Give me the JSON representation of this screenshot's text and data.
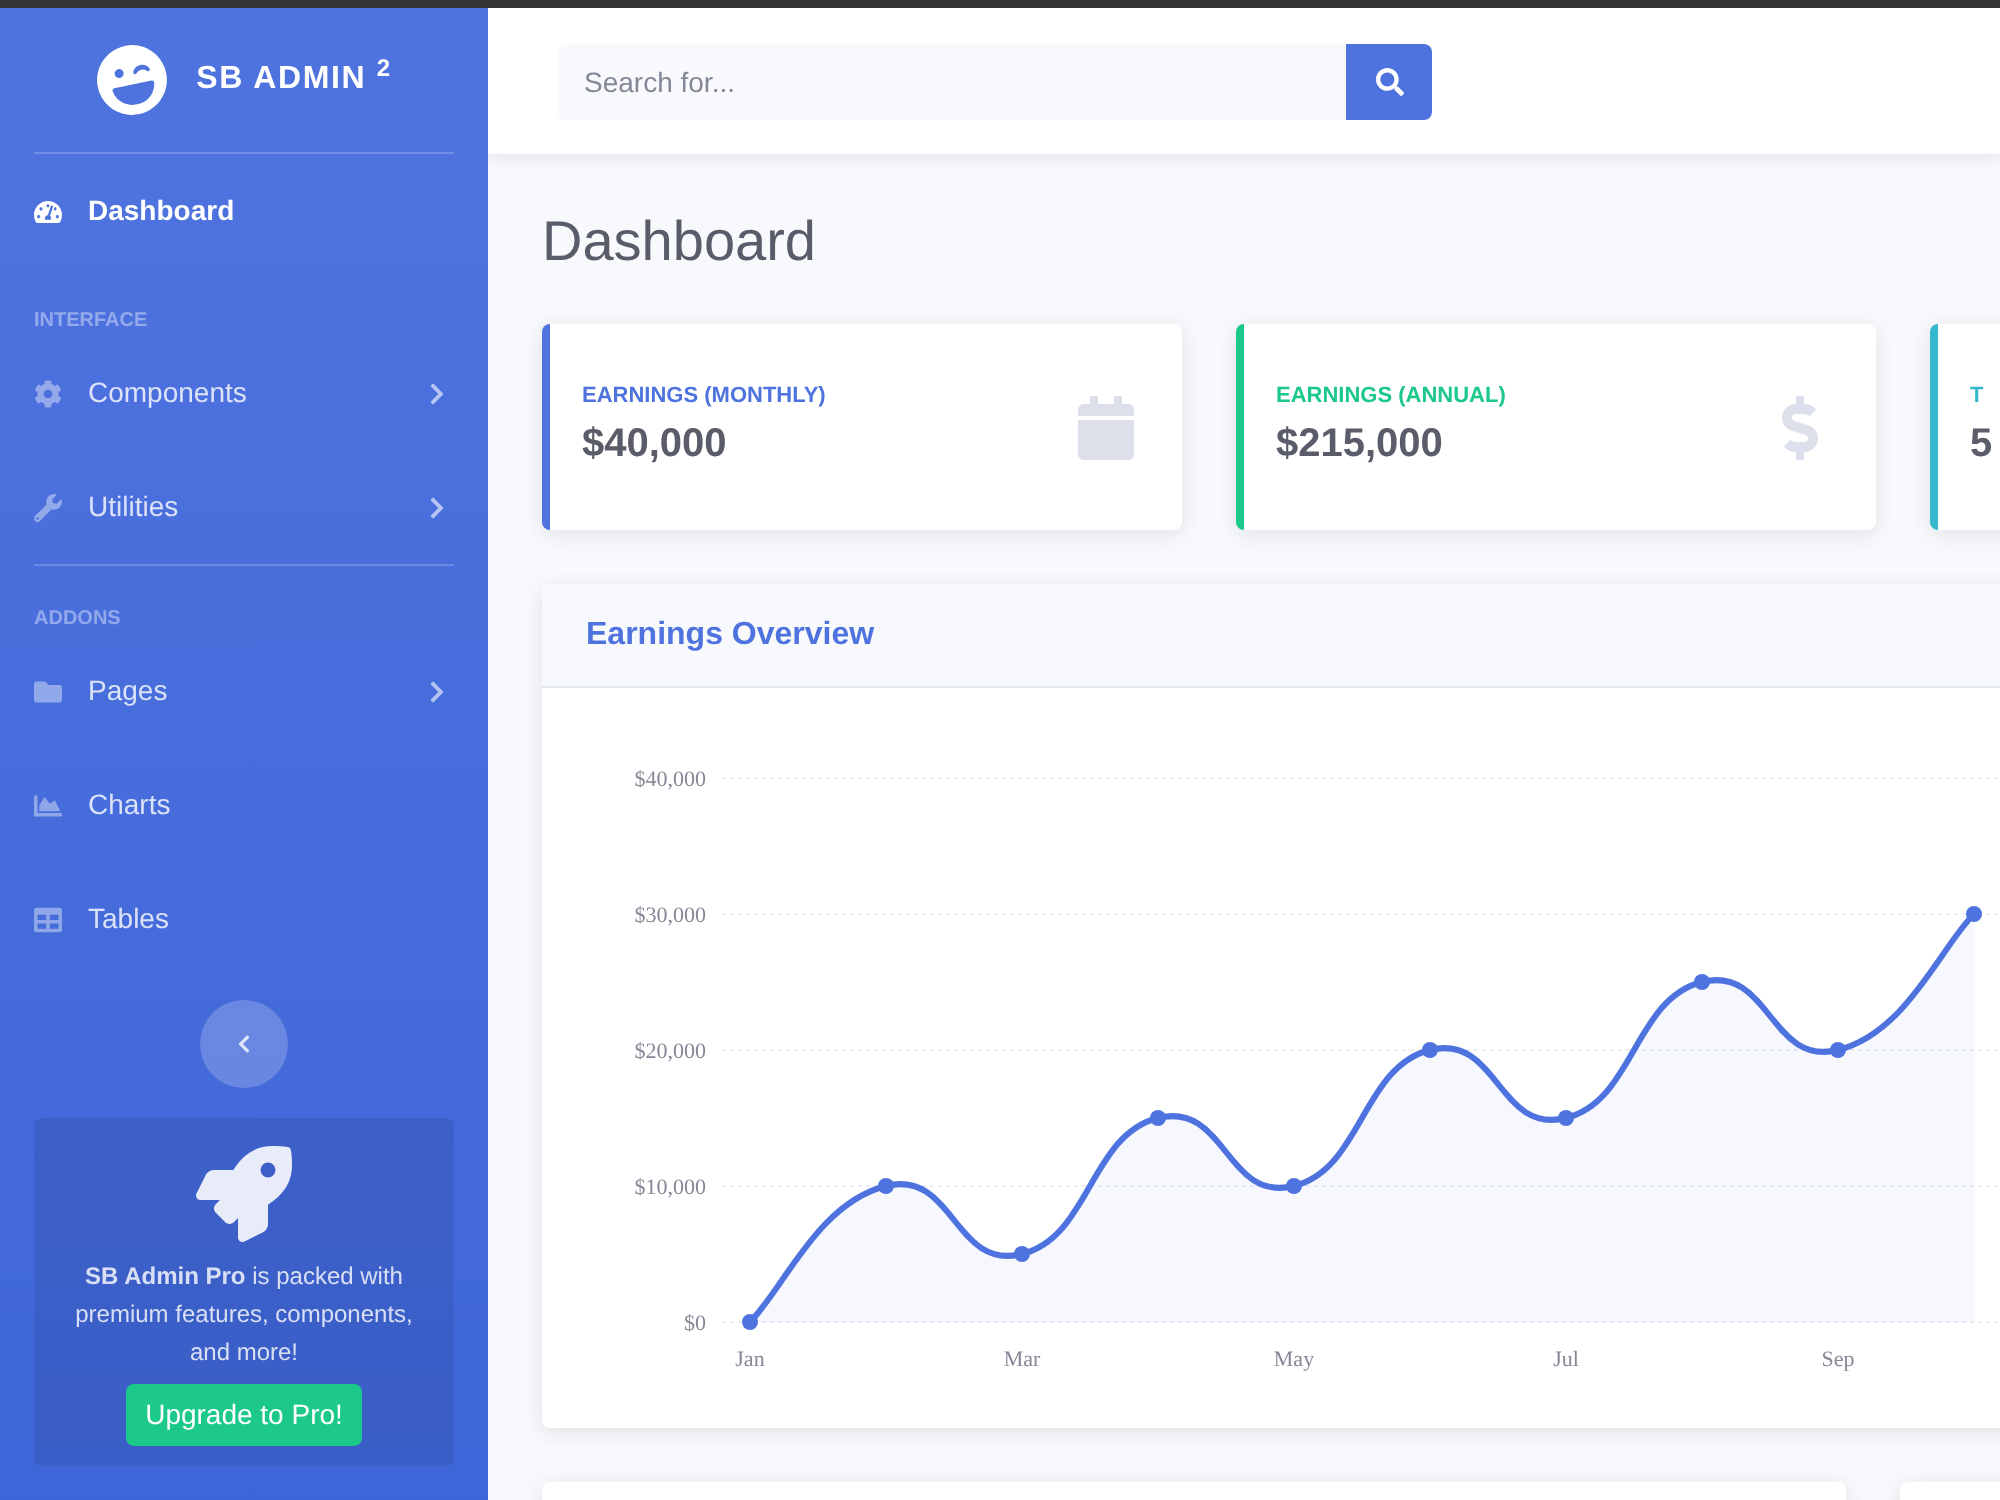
{
  "sidebar": {
    "brand": "SB ADMIN $^{2}$",
    "sections": [
      {
        "items": [
          {
            "label": "Dashboard",
            "kind": "link",
            "selected": true
          }
        ]
      },
      {
        "heading": "INTERFACE",
        "items": [
          {
            "label": "Components",
            "kind": "collapse",
            "selected": false
          },
          {
            "label": "Utilities",
            "kind": "collapse",
            "selected": false
          }
        ]
      },
      {
        "heading": "ADDONS",
        "items": [
          {
            "label": "Pages",
            "kind": "collapse",
            "selected": false
          },
          {
            "label": "Charts",
            "kind": "link",
            "selected": false
          },
          {
            "label": "Tables",
            "kind": "link",
            "selected": false
          }
        ]
      }
    ],
    "promo": {
      "text": "**SB Admin Pro** is packed with premium features, components, and more!",
      "button": "Upgrade to Pro!"
    }
  },
  "search": {
    "placeholder": "Search for..."
  },
  "page_title": "Dashboard",
  "stat_cards": [
    {
      "label": "EARNINGS (MONTHLY)",
      "value": "$40,000",
      "color": "#4e73df"
    },
    {
      "label": "EARNINGS (ANNUAL)",
      "value": "$215,000",
      "color": "#1cc88a"
    },
    {
      "label": "T",
      "value": "5",
      "color": "#36b9cc"
    }
  ],
  "earnings_card": {
    "title": "Earnings Overview",
    "chart_data": {
      "type": "area",
      "categories": [
        "Jan",
        null,
        "Mar",
        null,
        "May",
        null,
        "Jul",
        null,
        "Sep",
        null
      ],
      "ylim": [
        0,
        40000
      ],
      "grid": true,
      "yticks": [
        {
          "value": 0,
          "label": "$0"
        },
        {
          "value": 10000,
          "label": "$10,000"
        },
        {
          "value": 20000,
          "label": "$20,000"
        },
        {
          "value": 30000,
          "label": "$30,000"
        },
        {
          "value": 40000,
          "label": "$40,000"
        }
      ],
      "series": [
        {
          "color": "#4e73df",
          "values": [
            0,
            10000,
            5000,
            15000,
            10000,
            20000,
            15000,
            25000,
            20000,
            30000
          ]
        }
      ]
    }
  }
}
